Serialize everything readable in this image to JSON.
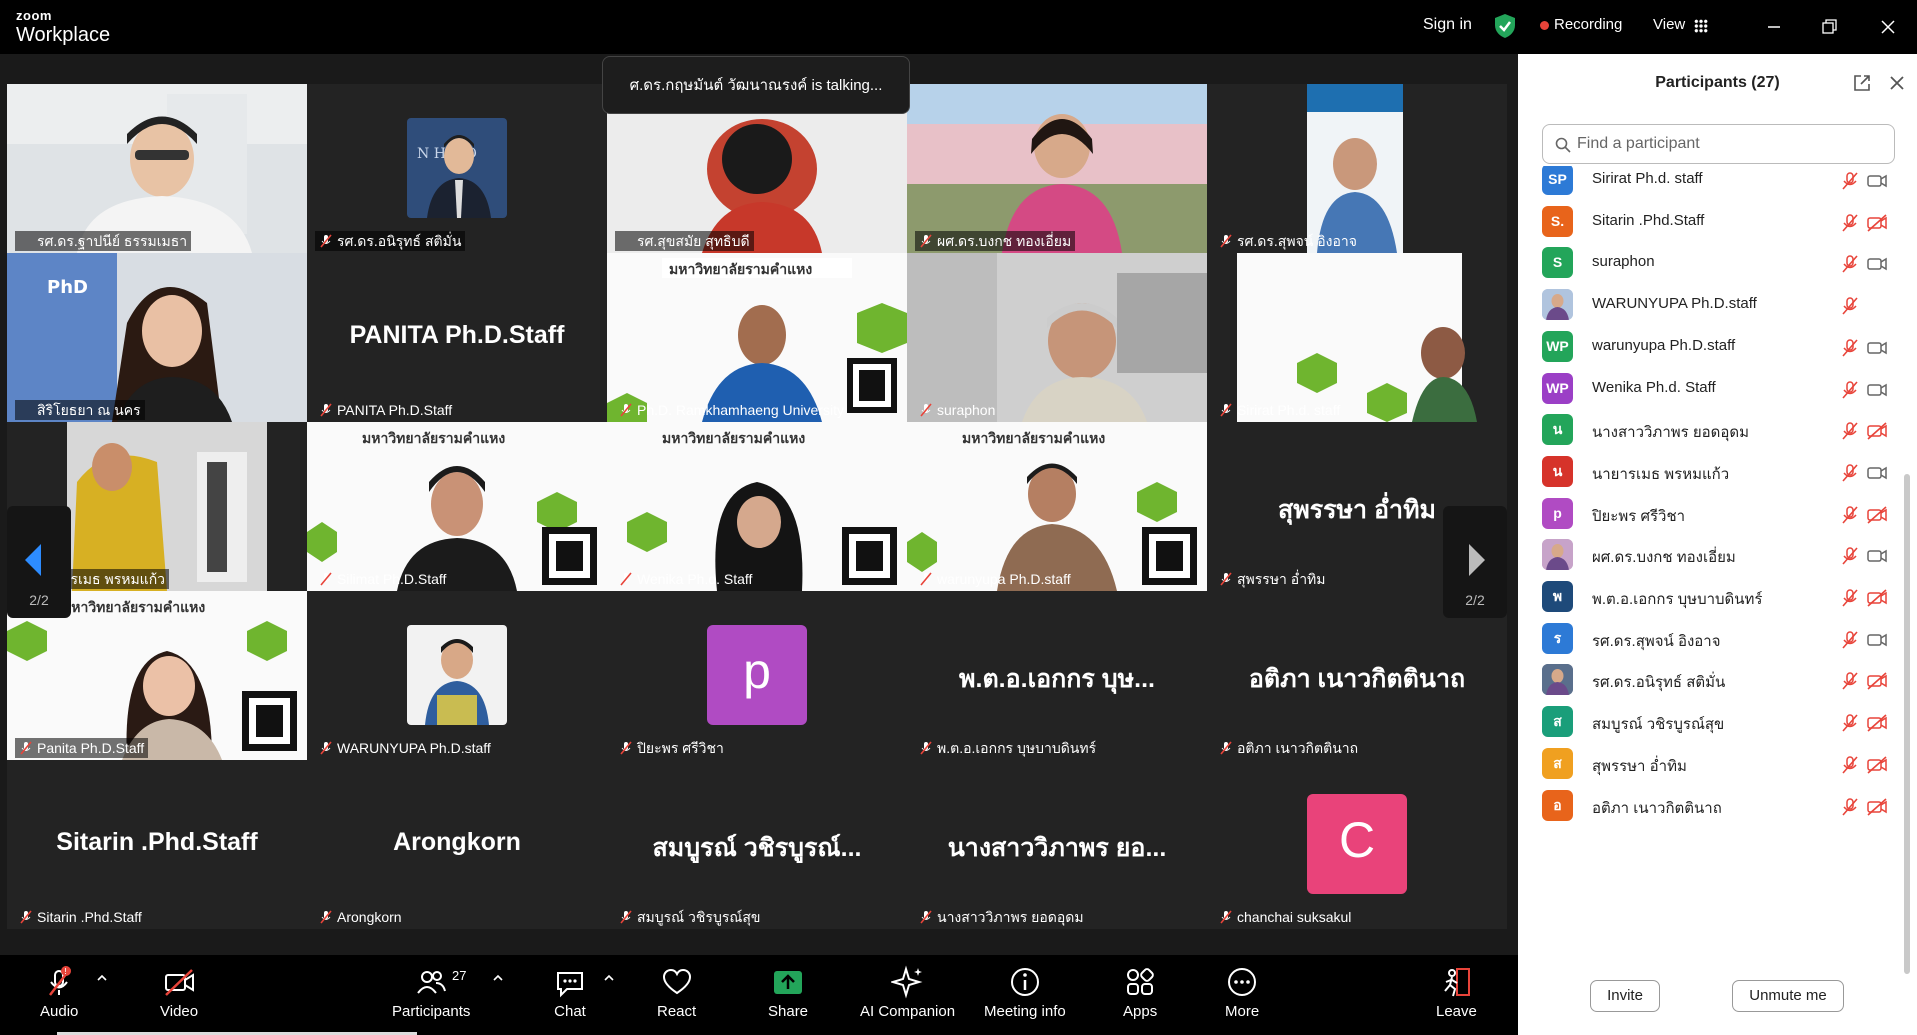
{
  "app": {
    "logo_small": "zoom",
    "logo_big": "Workplace"
  },
  "topbar": {
    "signin": "Sign in",
    "recording": "Recording",
    "view": "View"
  },
  "talking_banner": "ศ.ดร.กฤษมันต์  วัฒนาณรงค์ is talking...",
  "gallery": {
    "page_left": "2/2",
    "page_right": "2/2",
    "tiles": [
      {
        "label": "รศ.ดร.ฐาปนีย์  ธรรมเมธา",
        "big": ""
      },
      {
        "label": "รศ.ดร.อนิรุทธ์  สติมั่น",
        "big": ""
      },
      {
        "label": "รศ.สุขสมัย  สุทธิบดี",
        "big": ""
      },
      {
        "label": "ผศ.ดร.บงกช  ทองเอี่ยม",
        "big": ""
      },
      {
        "label": "รศ.ดร.สุพจน์  อิงอาจ",
        "big": ""
      },
      {
        "label": "สิริโยธยา  ณ นคร",
        "big": ""
      },
      {
        "label": "PANITA Ph.D.Staff",
        "big": "PANITA Ph.D.Staff"
      },
      {
        "label": "Ph.D. Ramkhamhaeng University",
        "big": ""
      },
      {
        "label": "suraphon",
        "big": ""
      },
      {
        "label": "Sirirat Ph.d. staff",
        "big": ""
      },
      {
        "label": "นายารเมธ  พรหมแก้ว",
        "big": ""
      },
      {
        "label": "Silimat Ph.D.Staff",
        "big": ""
      },
      {
        "label": "Wenika Ph.d. Staff",
        "big": ""
      },
      {
        "label": "warunyupa Ph.D.staff",
        "big": ""
      },
      {
        "label": "สุพรรษา  อ่ำทิม",
        "big": "สุพรรษา  อ่ำทิม"
      },
      {
        "label": "Panita Ph.D.Staff",
        "big": ""
      },
      {
        "label": "WARUNYUPA Ph.D.staff",
        "big": ""
      },
      {
        "label": "ปิยะพร  ศรีวิชา",
        "big": "",
        "avatar": "p"
      },
      {
        "label": "พ.ต.อ.เอกกร  บุษบาบดินทร์",
        "big": "พ.ต.อ.เอกกร  บุษ..."
      },
      {
        "label": "อติภา  เนาวกิตตินาถ",
        "big": "อติภา  เนาวกิตตินาถ"
      },
      {
        "label": "Sitarin .Phd.Staff",
        "big": "Sitarin .Phd.Staff"
      },
      {
        "label": "Arongkorn",
        "big": "Arongkorn"
      },
      {
        "label": "สมบูรณ์  วชิรบูรณ์สุข",
        "big": "สมบูรณ์  วชิรบูรณ์..."
      },
      {
        "label": "นางสาววิภาพร  ยอดอุดม",
        "big": "นางสาววิภาพร  ยอ..."
      },
      {
        "label": "chanchai suksakul",
        "big": "",
        "avatar": "C"
      }
    ]
  },
  "toolbar": {
    "audio": "Audio",
    "video": "Video",
    "participants": "Participants",
    "participants_count": "27",
    "chat": "Chat",
    "react": "React",
    "share": "Share",
    "ai": "AI Companion",
    "meeting_info": "Meeting info",
    "apps": "Apps",
    "more": "More",
    "leave": "Leave"
  },
  "panel": {
    "title": "Participants (27)",
    "search_placeholder": "Find a participant",
    "invite": "Invite",
    "unmute_me": "Unmute me",
    "participants": [
      {
        "initials": "SP",
        "name": "Sirirat Ph.d. staff",
        "color": "#2d7ad6",
        "cam_off": false
      },
      {
        "initials": "S.",
        "name": "Sitarin .Phd.Staff",
        "color": "#e8641b",
        "cam_off": true
      },
      {
        "initials": "S",
        "name": "suraphon",
        "color": "#23a55a",
        "cam_off": false
      },
      {
        "initials": "",
        "name": "WARUNYUPA Ph.D.staff",
        "color": "#b0c4de",
        "cam_off": false,
        "photo": true
      },
      {
        "initials": "WP",
        "name": "warunyupa Ph.D.staff",
        "color": "#23a55a",
        "cam_off": false
      },
      {
        "initials": "WP",
        "name": "Wenika Ph.d. Staff",
        "color": "#9b3fc6",
        "cam_off": false
      },
      {
        "initials": "น",
        "name": "นางสาววิภาพร  ยอดอุดม",
        "color": "#23a55a",
        "cam_off": true
      },
      {
        "initials": "น",
        "name": "นายารเมธ  พรหมแก้ว",
        "color": "#d6332a",
        "cam_off": false
      },
      {
        "initials": "p",
        "name": "ปิยะพร  ศรีวิชา",
        "color": "#b04bc3",
        "cam_off": true
      },
      {
        "initials": "",
        "name": "ผศ.ดร.บงกช  ทองเอี่ยม",
        "color": "#c7a3c9",
        "cam_off": false,
        "photo": true
      },
      {
        "initials": "พ",
        "name": "พ.ต.อ.เอกกร  บุษบาบดินทร์",
        "color": "#1e4a7a",
        "cam_off": true
      },
      {
        "initials": "ร",
        "name": "รศ.ดร.สุพจน์  อิงอาจ",
        "color": "#2d7ad6",
        "cam_off": false
      },
      {
        "initials": "",
        "name": "รศ.ดร.อนิรุทธ์  สติมั่น",
        "color": "#5a6f8c",
        "cam_off": true,
        "photo": true
      },
      {
        "initials": "ส",
        "name": "สมบูรณ์  วชิรบูรณ์สุข",
        "color": "#1a9e7a",
        "cam_off": true
      },
      {
        "initials": "ส",
        "name": "สุพรรษา  อ่ำทิม",
        "color": "#f0a020",
        "cam_off": true
      },
      {
        "initials": "อ",
        "name": "อติภา  เนาวกิตตินาถ",
        "color": "#e8641b",
        "cam_off": true
      }
    ]
  },
  "colors": {
    "muted_red": "#e8443a",
    "accent_green": "#23a55a",
    "panel_bg": "#ffffff"
  }
}
